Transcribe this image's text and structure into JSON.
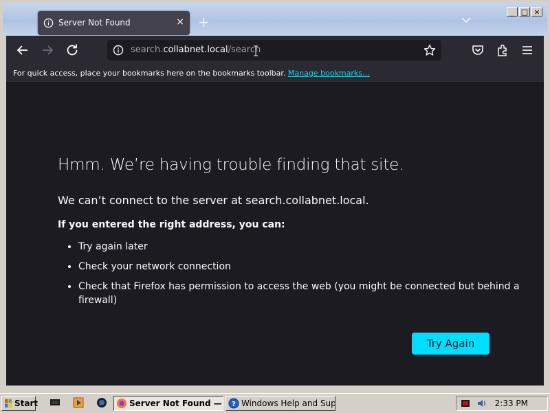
{
  "window": {
    "controls": [
      "_",
      "□",
      "×"
    ]
  },
  "tab": {
    "title": "Server Not Found",
    "close_icon": "×",
    "new_tab_icon": "+"
  },
  "urlbar": {
    "prefix": "search.",
    "host": "collabnet.local",
    "path": "/search"
  },
  "bookmarks_bar": {
    "message": "For quick access, place your bookmarks here on the bookmarks toolbar.",
    "link": "Manage bookmarks…"
  },
  "error_page": {
    "title": "Hmm. We’re having trouble finding that site.",
    "description": "We can’t connect to the server at search.collabnet.local.",
    "subheading": "If you entered the right address, you can:",
    "suggestions": [
      "Try again later",
      "Check your network connection",
      "Check that Firefox has permission to access the web (you might be connected but behind a firewall)"
    ],
    "button_label": "Try Again"
  },
  "taskbar": {
    "start_label": "Start",
    "tasks": [
      {
        "label": "Server Not Found — ..."
      },
      {
        "label": "Windows Help and Sup..."
      }
    ],
    "clock": "2:33 PM"
  },
  "colors": {
    "accent": "#00ddff",
    "content_bg": "#1c1b22",
    "toolbar_bg": "#2b2a33",
    "tab_bg": "#42414d"
  }
}
